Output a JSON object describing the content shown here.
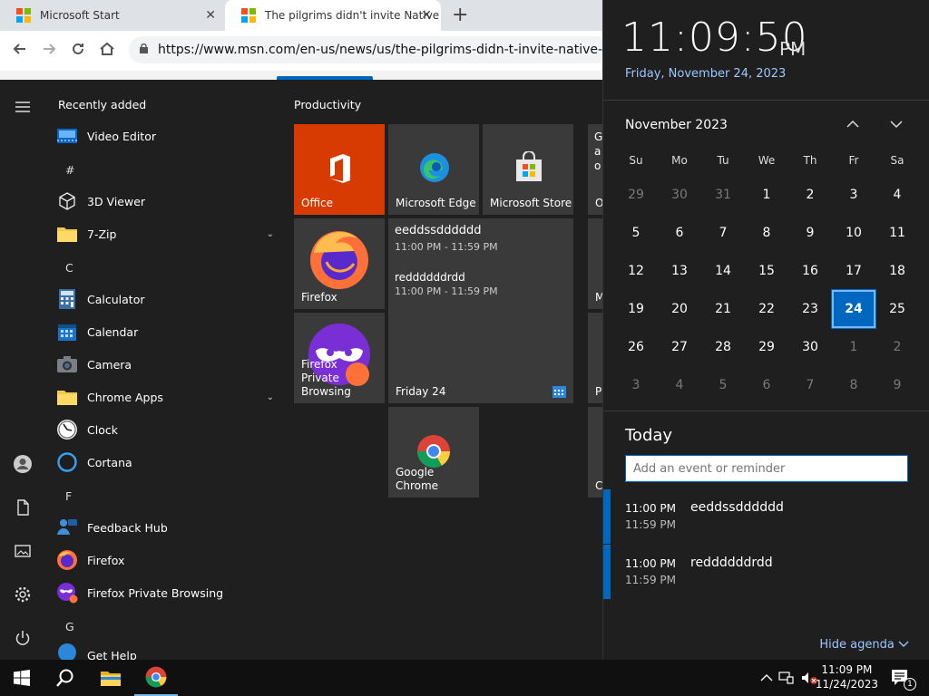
{
  "browser": {
    "tabs": [
      {
        "title": "Microsoft Start",
        "close": "✕"
      },
      {
        "title": "The pilgrims didn't invite Native",
        "close": "✕"
      }
    ],
    "new_tab": "+",
    "url": "https://www.msn.com/en-us/news/us/the-pilgrims-didn-t-invite-native-america"
  },
  "start": {
    "recent_header": "Recently added",
    "apps": [
      {
        "kind": "app",
        "label": "Video Editor",
        "icon": "video-editor-icon"
      },
      {
        "kind": "letter",
        "label": "#"
      },
      {
        "kind": "app",
        "label": "3D Viewer",
        "icon": "cube-icon"
      },
      {
        "kind": "app",
        "label": "7-Zip",
        "icon": "folder-icon",
        "expand": "⌄"
      },
      {
        "kind": "letter",
        "label": "C"
      },
      {
        "kind": "app",
        "label": "Calculator",
        "icon": "calculator-icon"
      },
      {
        "kind": "app",
        "label": "Calendar",
        "icon": "calendar-icon"
      },
      {
        "kind": "app",
        "label": "Camera",
        "icon": "camera-icon"
      },
      {
        "kind": "app",
        "label": "Chrome Apps",
        "icon": "folder-icon",
        "expand": "⌄"
      },
      {
        "kind": "app",
        "label": "Clock",
        "icon": "clock-icon"
      },
      {
        "kind": "app",
        "label": "Cortana",
        "icon": "cortana-icon"
      },
      {
        "kind": "letter",
        "label": "F"
      },
      {
        "kind": "app",
        "label": "Feedback Hub",
        "icon": "feedback-icon"
      },
      {
        "kind": "app",
        "label": "Firefox",
        "icon": "firefox-icon"
      },
      {
        "kind": "app",
        "label": "Firefox Private Browsing",
        "icon": "firefox-private-icon"
      },
      {
        "kind": "letter",
        "label": "G"
      },
      {
        "kind": "app",
        "label": "Get Help",
        "icon": "help-icon"
      }
    ],
    "group_title": "Productivity",
    "tiles": {
      "office": "Office",
      "edge": "Microsoft Edge",
      "store": "Microsoft Store",
      "firefox": "Firefox",
      "firefox_private": "Firefox Private Browsing",
      "chrome": "Google Chrome",
      "calendar_tile": {
        "events": [
          {
            "title": "eeddssdddddd",
            "time": "11:00 PM - 11:59 PM"
          },
          {
            "title": "reddddddrdd",
            "time": "11:00 PM - 11:59 PM"
          }
        ],
        "footer": "Friday 24"
      },
      "partial_letters": [
        "G",
        "a",
        "o",
        "O",
        "M",
        "P",
        "C"
      ]
    }
  },
  "flyout": {
    "time": "11:09:50",
    "ampm": "PM",
    "date": "Friday, November 24, 2023",
    "month_label": "November 2023",
    "weekdays": [
      "Su",
      "Mo",
      "Tu",
      "We",
      "Th",
      "Fr",
      "Sa"
    ],
    "weeks": [
      [
        "29",
        "30",
        "31",
        "1",
        "2",
        "3",
        "4"
      ],
      [
        "5",
        "6",
        "7",
        "8",
        "9",
        "10",
        "11"
      ],
      [
        "12",
        "13",
        "14",
        "15",
        "16",
        "17",
        "18"
      ],
      [
        "19",
        "20",
        "21",
        "22",
        "23",
        "24",
        "25"
      ],
      [
        "26",
        "27",
        "28",
        "29",
        "30",
        "1",
        "2"
      ],
      [
        "3",
        "4",
        "5",
        "6",
        "7",
        "8",
        "9"
      ]
    ],
    "selected_day": "24",
    "today_header": "Today",
    "add_placeholder": "Add an event or reminder",
    "agenda": [
      {
        "start": "11:00 PM",
        "end": "11:59 PM",
        "title": "eeddssdddddd"
      },
      {
        "start": "11:00 PM",
        "end": "11:59 PM",
        "title": "reddddddrdd"
      }
    ],
    "hide_agenda": "Hide agenda"
  },
  "taskbar": {
    "time": "11:09 PM",
    "date": "11/24/2023",
    "notification_count": "1"
  },
  "colors": {
    "accent": "#0067c0",
    "office": "#d83b01",
    "start_bg": "#1f1f1f",
    "tile_bg": "#3a3a3a"
  }
}
